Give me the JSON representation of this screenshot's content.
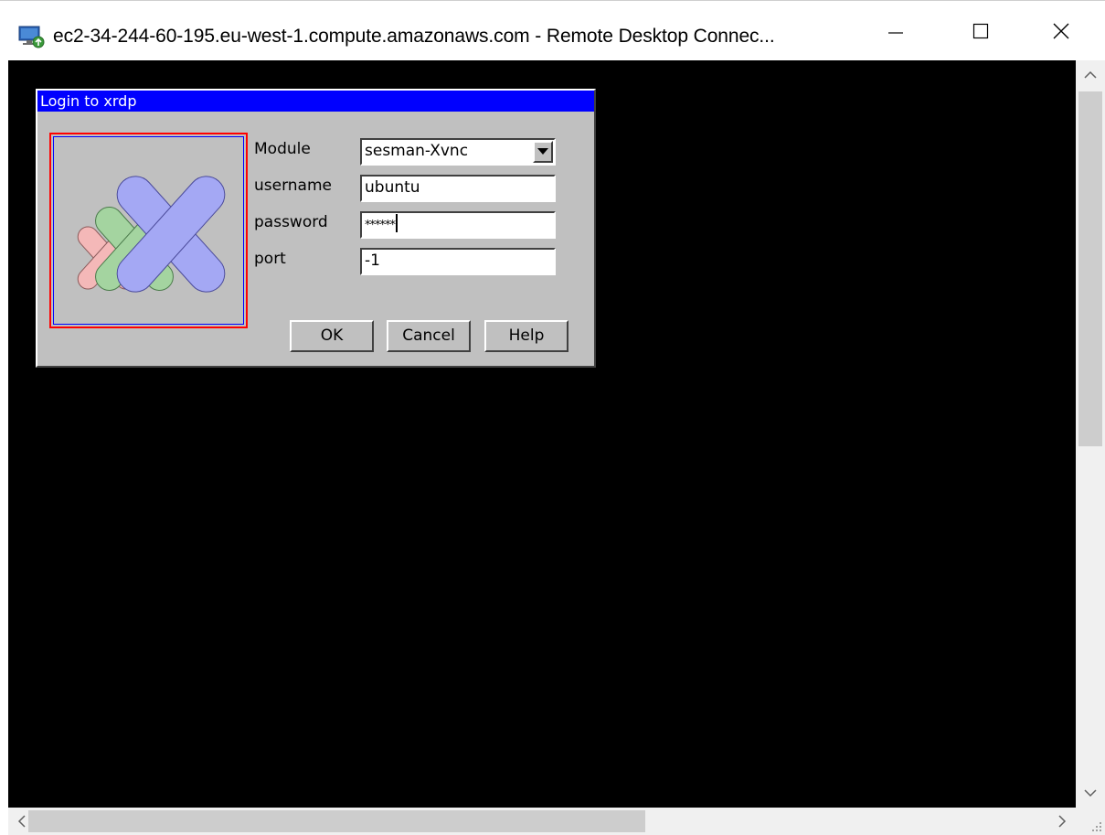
{
  "window": {
    "title": "ec2-34-244-60-195.eu-west-1.compute.amazonaws.com - Remote Desktop Connec...",
    "app_icon": "remote-desktop-icon",
    "controls": {
      "minimize": "minimize-icon",
      "maximize": "maximize-icon",
      "close": "close-icon"
    }
  },
  "dialog": {
    "title": "Login to xrdp",
    "logo": "xrdp-logo",
    "fields": {
      "module": {
        "label": "Module",
        "value": "sesman-Xvnc"
      },
      "username": {
        "label": "username",
        "value": "ubuntu"
      },
      "password": {
        "label": "password",
        "value": "******"
      },
      "port": {
        "label": "port",
        "value": "-1"
      }
    },
    "buttons": {
      "ok": "OK",
      "cancel": "Cancel",
      "help": "Help"
    }
  },
  "colors": {
    "dialog_bg": "#c0c0c0",
    "dialog_titlebar": "#0000ff",
    "remote_bg": "#000000",
    "logo_border": "#ff0000",
    "logo_inner_border": "#0000ff"
  },
  "scrollbars": {
    "vertical": true,
    "horizontal": true
  }
}
